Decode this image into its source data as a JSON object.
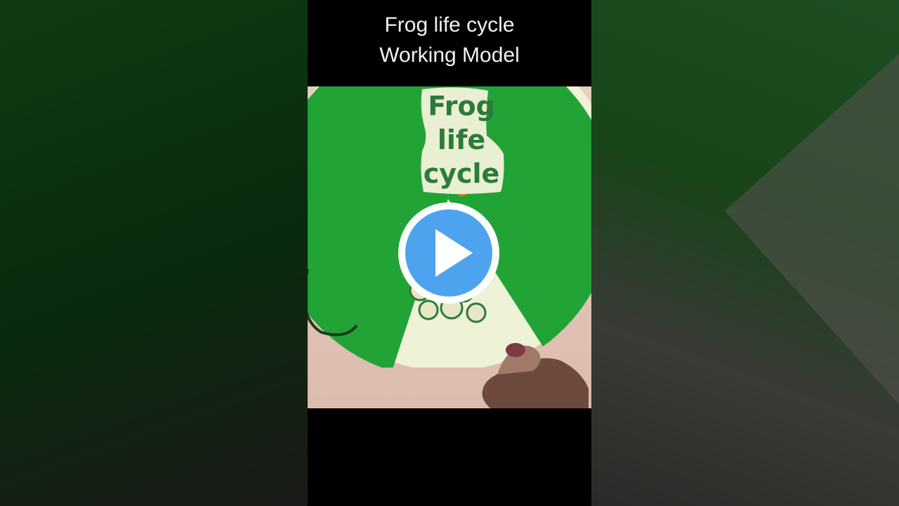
{
  "video": {
    "caption_line1": "Frog life cycle",
    "caption_line2": "Working Model",
    "model_label_line1": "Frog",
    "model_label_line2": "life",
    "model_label_line3": "cycle"
  },
  "controls": {
    "play_icon": "play-icon"
  },
  "colors": {
    "disc_green": "#22a336",
    "cream": "#eef2d6",
    "play_blue": "#4ea3ee",
    "label_green": "#2d7a3a"
  }
}
